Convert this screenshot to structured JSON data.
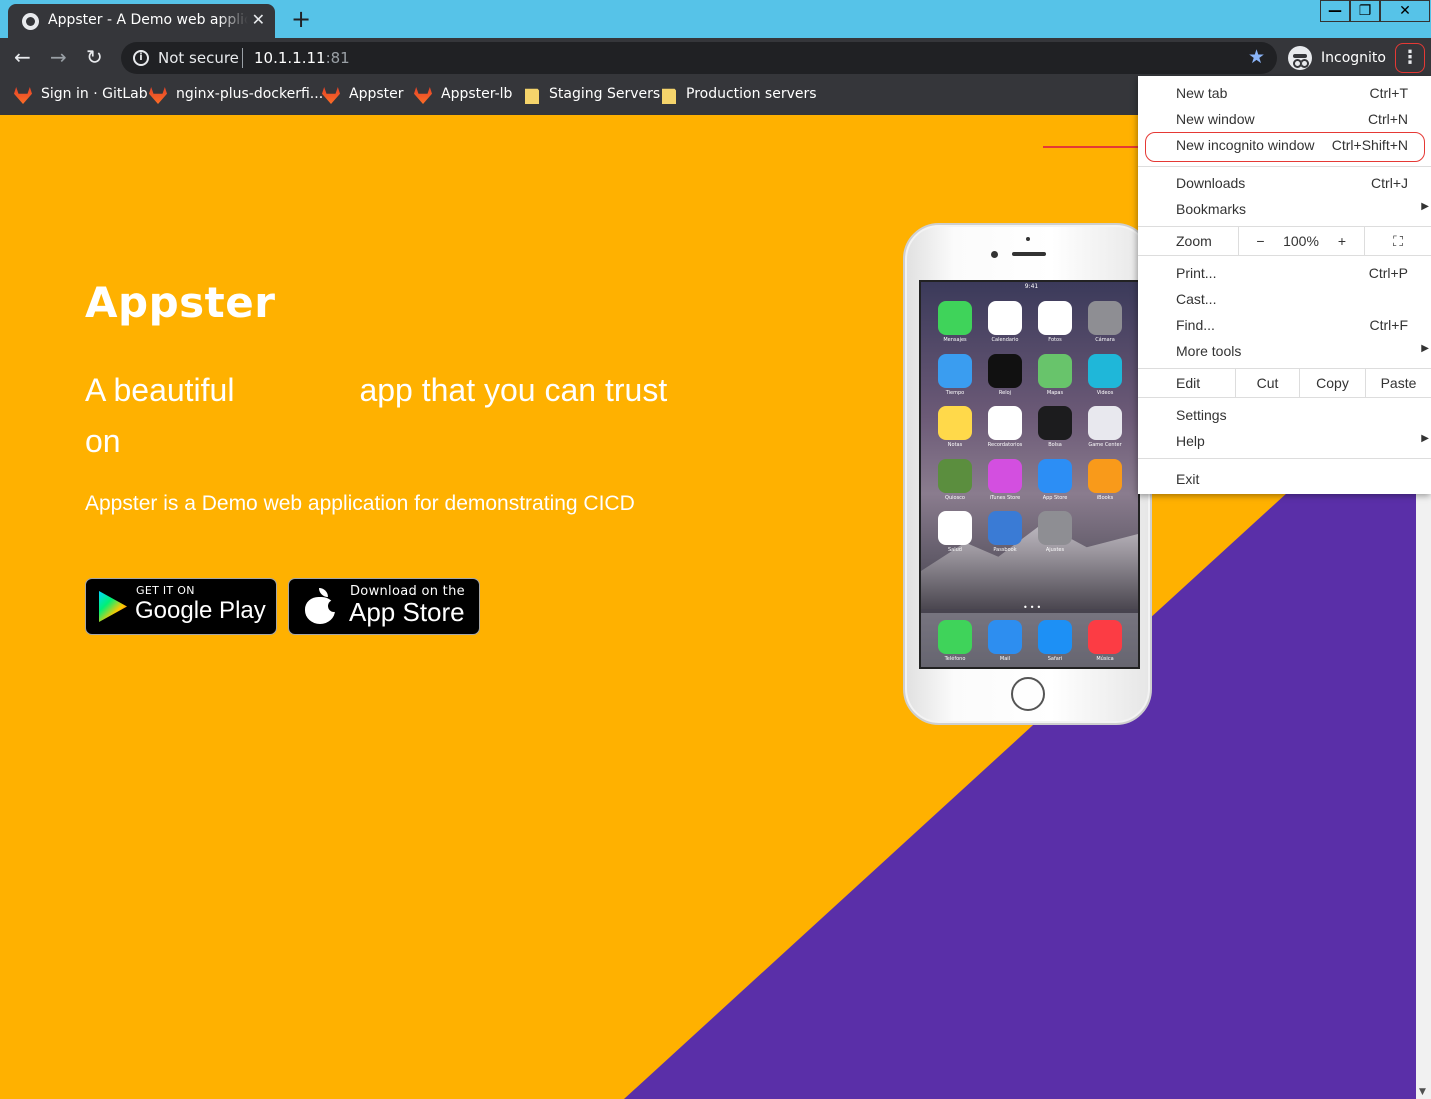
{
  "browser": {
    "tab_title": "Appster - A Demo web application",
    "tab_close": "✕",
    "new_tab": "+",
    "window_controls": {
      "minimize": "—",
      "maximize": "❐",
      "close": "✕"
    },
    "security_text": "Not secure",
    "url_host": "10.1.1.11",
    "url_port": ":81",
    "profile_label": "Incognito",
    "menu_icon": "⋮"
  },
  "bookmarks": [
    {
      "label": "Sign in · GitLab",
      "icon": "gitlab-icon"
    },
    {
      "label": "nginx-plus-dockerfi...",
      "icon": "gitlab-icon"
    },
    {
      "label": "Appster",
      "icon": "gitlab-icon"
    },
    {
      "label": "Appster-lb",
      "icon": "gitlab-icon"
    },
    {
      "label": "Staging Servers",
      "icon": "folder-icon"
    },
    {
      "label": "Production servers",
      "icon": "folder-icon"
    }
  ],
  "page": {
    "title": "Appster",
    "tagline_part1": "A beautiful",
    "tagline_part2": "app that you can trust",
    "tagline_part3": "on",
    "description": "Appster is a Demo web application for demonstrating CICD",
    "google_play_small": "GET IT ON",
    "google_play_big": "Google Play",
    "app_store_small": "Download on the",
    "app_store_big": "App Store",
    "phone_status_time": "9:41",
    "phone_apps": [
      {
        "label": "Mensajes",
        "color": "#3fd35a"
      },
      {
        "label": "Calendario",
        "color": "#ffffff"
      },
      {
        "label": "Fotos",
        "color": "#ffffff"
      },
      {
        "label": "Cámara",
        "color": "#8e8e93"
      },
      {
        "label": "Tiempo",
        "color": "#3a9df0"
      },
      {
        "label": "Reloj",
        "color": "#111111"
      },
      {
        "label": "Mapas",
        "color": "#68c46b"
      },
      {
        "label": "Videos",
        "color": "#1fb7d9"
      },
      {
        "label": "Notas",
        "color": "#ffd94a"
      },
      {
        "label": "Recordatorios",
        "color": "#ffffff"
      },
      {
        "label": "Bolsa",
        "color": "#1c1c1e"
      },
      {
        "label": "Game Center",
        "color": "#e8e8ee"
      },
      {
        "label": "Quiosco",
        "color": "#5b8e3e"
      },
      {
        "label": "iTunes Store",
        "color": "#d34fe0"
      },
      {
        "label": "App Store",
        "color": "#2c8ef5"
      },
      {
        "label": "iBooks",
        "color": "#f99a1a"
      },
      {
        "label": "Salud",
        "color": "#ffffff"
      },
      {
        "label": "Passbook",
        "color": "#3a7bd5"
      },
      {
        "label": "Ajustes",
        "color": "#8e8e93"
      }
    ],
    "dock_apps": [
      {
        "label": "Teléfono",
        "color": "#3fd35a"
      },
      {
        "label": "Mail",
        "color": "#2d8ef0"
      },
      {
        "label": "Safari",
        "color": "#1d90f5"
      },
      {
        "label": "Música",
        "color": "#fc3c44"
      }
    ]
  },
  "menu": {
    "new_tab": {
      "label": "New tab",
      "shortcut": "Ctrl+T"
    },
    "new_window": {
      "label": "New window",
      "shortcut": "Ctrl+N"
    },
    "new_incognito": {
      "label": "New incognito window",
      "shortcut": "Ctrl+Shift+N"
    },
    "downloads": {
      "label": "Downloads",
      "shortcut": "Ctrl+J"
    },
    "bookmarks": {
      "label": "Bookmarks"
    },
    "zoom": {
      "label": "Zoom",
      "minus": "−",
      "value": "100%",
      "plus": "+"
    },
    "print": {
      "label": "Print...",
      "shortcut": "Ctrl+P"
    },
    "cast": {
      "label": "Cast..."
    },
    "find": {
      "label": "Find...",
      "shortcut": "Ctrl+F"
    },
    "more_tools": {
      "label": "More tools"
    },
    "edit": {
      "label": "Edit",
      "cut": "Cut",
      "copy": "Copy",
      "paste": "Paste"
    },
    "settings": {
      "label": "Settings"
    },
    "help": {
      "label": "Help"
    },
    "exit": {
      "label": "Exit"
    }
  },
  "colors": {
    "page_bg": "#ffb100",
    "purple": "#5a2fa8",
    "highlight": "#e53935",
    "titlebar": "#56c3e8",
    "toolbar": "#35363a"
  }
}
